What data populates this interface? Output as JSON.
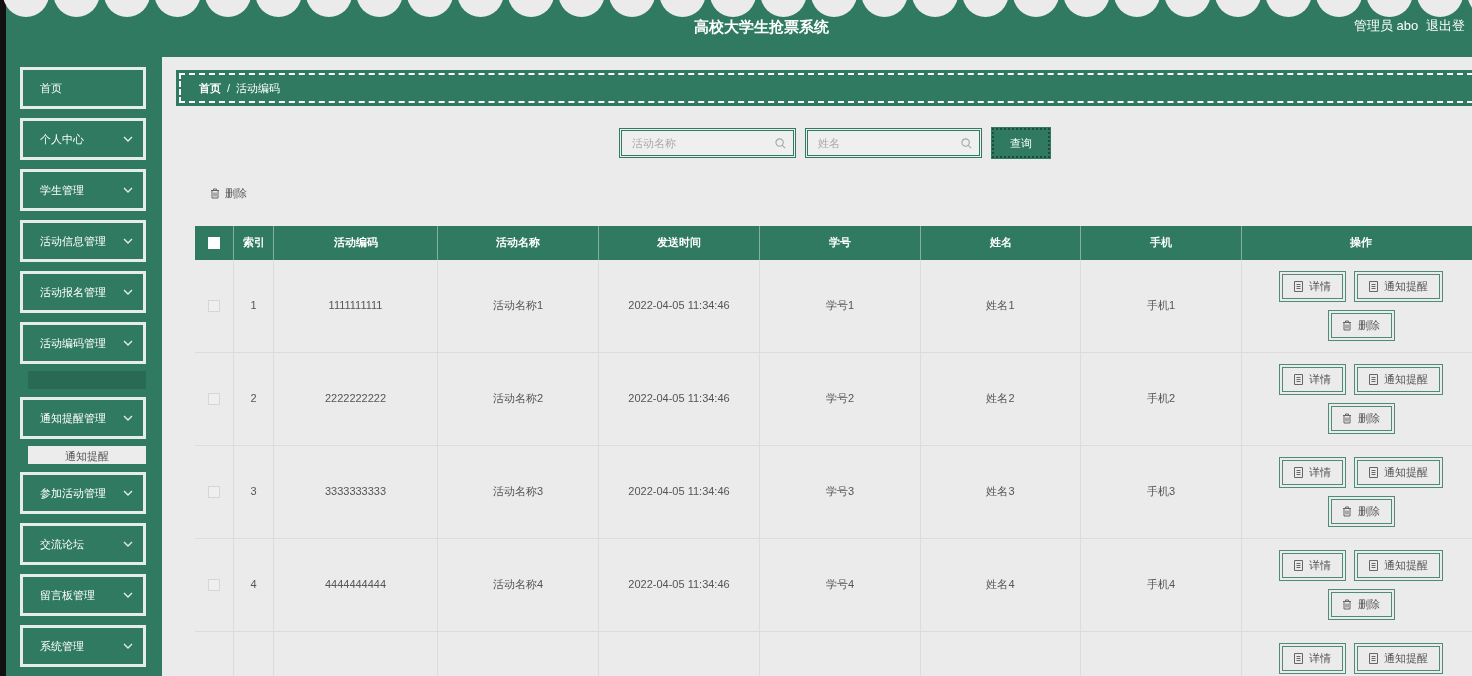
{
  "header": {
    "title": "高校大学生抢票系统",
    "user": "管理员 abo",
    "logout": "退出登"
  },
  "sidebar": {
    "items": [
      {
        "label": "首页",
        "expandable": false
      },
      {
        "label": "个人中心",
        "expandable": true
      },
      {
        "label": "学生管理",
        "expandable": true
      },
      {
        "label": "活动信息管理",
        "expandable": true
      },
      {
        "label": "活动报名管理",
        "expandable": true
      },
      {
        "label": "活动编码管理",
        "expandable": true,
        "children": [
          {
            "selected": true
          }
        ]
      },
      {
        "label": "通知提醒管理",
        "expandable": true,
        "children": [
          {
            "label": "通知提醒",
            "selected": false
          }
        ]
      },
      {
        "label": "参加活动管理",
        "expandable": true
      },
      {
        "label": "交流论坛",
        "expandable": true
      },
      {
        "label": "留言板管理",
        "expandable": true
      },
      {
        "label": "系统管理",
        "expandable": true
      }
    ]
  },
  "breadcrumb": {
    "items": [
      "首页",
      "活动编码"
    ],
    "separator": "/"
  },
  "search": {
    "fields": [
      {
        "placeholder": "活动名称"
      },
      {
        "placeholder": "姓名"
      }
    ],
    "button": "查询"
  },
  "toolbar": {
    "delete": "删除"
  },
  "table": {
    "all_checked": false,
    "columns": [
      "索引",
      "活动编码",
      "活动名称",
      "发送时间",
      "学号",
      "姓名",
      "手机",
      "操作"
    ],
    "rows": [
      {
        "checked": false,
        "cells": [
          "1",
          "1111111111",
          "活动名称1",
          "2022-04-05 11:34:46",
          "学号1",
          "姓名1",
          "手机1"
        ],
        "actions": [
          "详情",
          "通知提醒",
          "删除"
        ]
      },
      {
        "checked": false,
        "cells": [
          "2",
          "2222222222",
          "活动名称2",
          "2022-04-05 11:34:46",
          "学号2",
          "姓名2",
          "手机2"
        ],
        "actions": [
          "详情",
          "通知提醒",
          "删除"
        ]
      },
      {
        "checked": false,
        "cells": [
          "3",
          "3333333333",
          "活动名称3",
          "2022-04-05 11:34:46",
          "学号3",
          "姓名3",
          "手机3"
        ],
        "actions": [
          "详情",
          "通知提醒",
          "删除"
        ]
      },
      {
        "checked": false,
        "cells": [
          "4",
          "4444444444",
          "活动名称4",
          "2022-04-05 11:34:46",
          "学号4",
          "姓名4",
          "手机4"
        ],
        "actions": [
          "详情",
          "通知提醒",
          "删除"
        ]
      },
      {
        "cells": [],
        "actions": [
          "详情",
          "通知提醒"
        ]
      }
    ]
  }
}
